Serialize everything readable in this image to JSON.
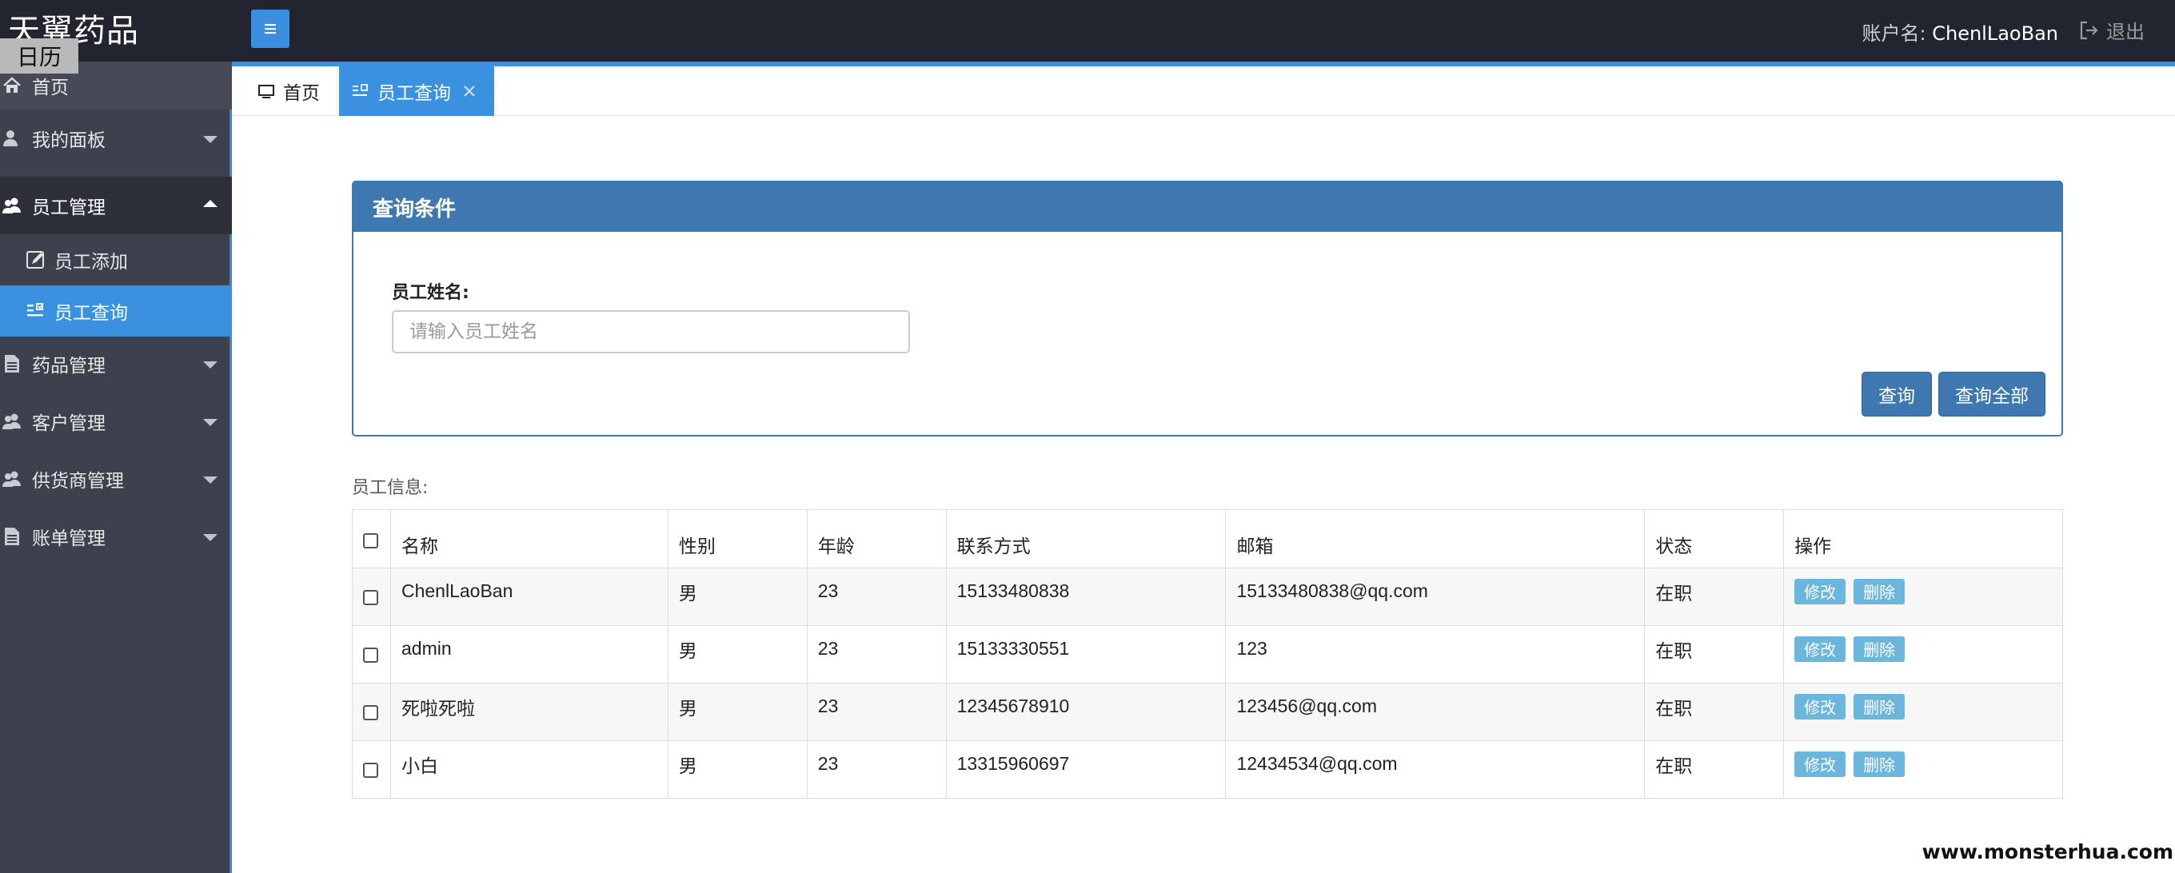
{
  "app": {
    "brand": "天翼药品",
    "calendar_tip": "日历"
  },
  "header": {
    "account_label": "账户名:",
    "account_name": "ChenlLaoBan",
    "logout_label": "退出"
  },
  "sidebar": {
    "items": [
      {
        "label": "首页",
        "icon": "home-icon"
      },
      {
        "label": "我的面板",
        "icon": "user-icon"
      },
      {
        "label": "员工管理",
        "icon": "users-icon",
        "expanded": true,
        "children": [
          {
            "label": "员工添加",
            "icon": "edit-icon"
          },
          {
            "label": "员工查询",
            "icon": "list-icon",
            "active": true
          }
        ]
      },
      {
        "label": "药品管理",
        "icon": "file-icon"
      },
      {
        "label": "客户管理",
        "icon": "users-icon"
      },
      {
        "label": "供货商管理",
        "icon": "users-icon"
      },
      {
        "label": "账单管理",
        "icon": "file-icon"
      }
    ]
  },
  "tabs": [
    {
      "label": "首页",
      "icon": "monitor-icon"
    },
    {
      "label": "员工查询",
      "icon": "list-icon",
      "active": true
    }
  ],
  "search_panel": {
    "title": "查询条件",
    "field_label": "员工姓名:",
    "field_placeholder": "请输入员工姓名",
    "query_button": "查询",
    "query_all_button": "查询全部"
  },
  "employees": {
    "caption": "员工信息:",
    "columns": [
      "名称",
      "性别",
      "年龄",
      "联系方式",
      "邮箱",
      "状态",
      "操作"
    ],
    "rows": [
      [
        "ChenlLaoBan",
        "男",
        "23",
        "15133480838",
        "15133480838@qq.com",
        "在职"
      ],
      [
        "admin",
        "男",
        "23",
        "15133330551",
        "123",
        "在职"
      ],
      [
        "死啦死啦",
        "男",
        "23",
        "12345678910",
        "123456@qq.com",
        "在职"
      ],
      [
        "小白",
        "男",
        "23",
        "13315960697",
        "12434534@qq.com",
        "在职"
      ]
    ],
    "edit_label": "修改",
    "delete_label": "删除"
  },
  "watermark": "www.monsterhua.com",
  "colors": {
    "topbar": "#222530",
    "sidebar": "#3d414d",
    "accent": "#3a91e0",
    "panel": "#3f78b0",
    "op_button": "#6bb6dc"
  }
}
